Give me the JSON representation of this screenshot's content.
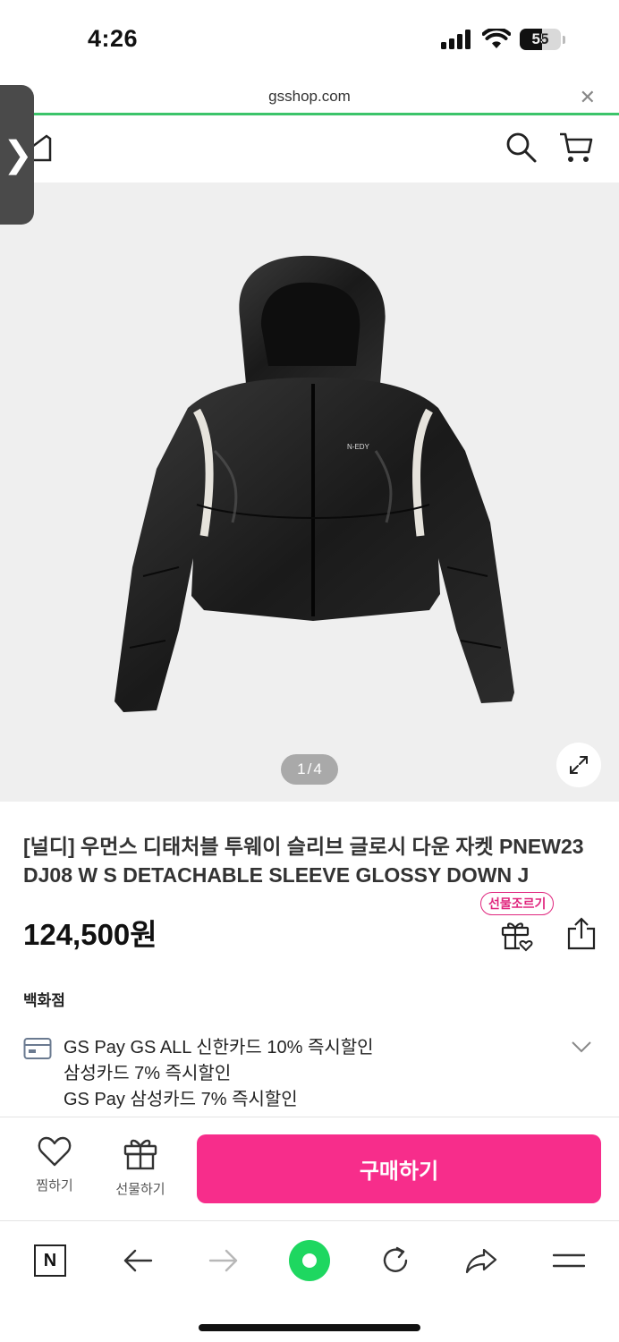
{
  "status_bar": {
    "time": "4:26",
    "battery": "55",
    "battery_level": 0.55
  },
  "browser": {
    "url": "gsshop.com",
    "close_glyph": "✕",
    "side_tab_glyph": "❯"
  },
  "header": {
    "icons": [
      "home-icon",
      "search-icon",
      "cart-icon"
    ]
  },
  "gallery": {
    "current": "1",
    "separator": "/",
    "total": "4"
  },
  "product": {
    "title": "[널디] 우먼스 디태처블 투웨이 슬리브 글로시 다운 자켓 PNEW23 DJ08 W S DETACHABLE SLEEVE GLOSSY DOWN J",
    "price": "124,500원",
    "gift_badge": "선물조르기",
    "jacket_logo": "N-EDY"
  },
  "store_label": "백화점",
  "promotions": [
    "GS Pay GS ALL 신한카드 10% 즉시할인",
    "삼성카드 7% 즉시할인",
    "GS Pay 삼성카드 7% 즉시할인"
  ],
  "actions": {
    "wish_label": "찜하기",
    "gift_label": "선물하기",
    "buy_label": "구매하기"
  },
  "browser_toolbar": {
    "n_label": "N",
    "icons": [
      "naver-n-icon",
      "back-arrow-icon",
      "forward-arrow-icon",
      "green-home-icon",
      "refresh-icon",
      "share-arrow-icon",
      "menu-icon"
    ]
  },
  "colors": {
    "accent": "#f72d8b",
    "badge": "#e0267e",
    "load_bar": "#3cc46a",
    "green_button": "#1ed760"
  }
}
